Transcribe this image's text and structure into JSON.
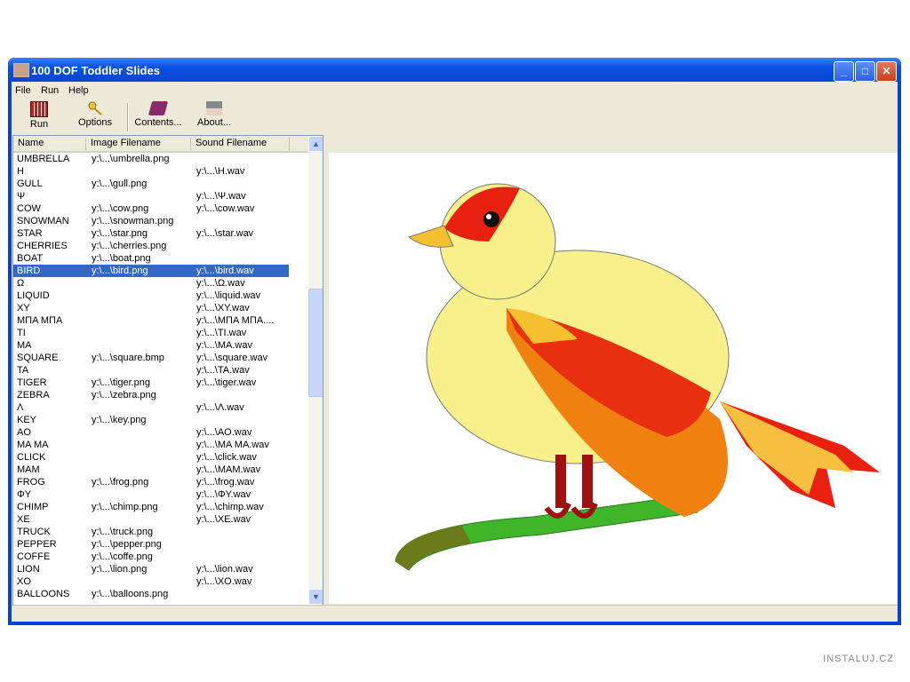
{
  "window": {
    "title": "100 DOF Toddler Slides",
    "controls": [
      "_",
      "□",
      "✕"
    ]
  },
  "menu": [
    "File",
    "Run",
    "Help"
  ],
  "toolbar": [
    {
      "label": "Run",
      "icon": "film-icon"
    },
    {
      "label": "Options",
      "icon": "key-icon"
    },
    {
      "label": "Contents...",
      "icon": "book-icon"
    },
    {
      "label": "About...",
      "icon": "picture-icon"
    }
  ],
  "list": {
    "columns": [
      "Name",
      "Image Filename",
      "Sound Filename"
    ],
    "selected": "BIRD",
    "rows": [
      [
        "UMBRELLA",
        "y:\\...\\umbrella.png",
        ""
      ],
      [
        "H",
        "",
        "y:\\...\\H.wav"
      ],
      [
        "GULL",
        "y:\\...\\gull.png",
        ""
      ],
      [
        "Ψ",
        "",
        "y:\\...\\Ψ.wav"
      ],
      [
        "COW",
        "y:\\...\\cow.png",
        "y:\\...\\cow.wav"
      ],
      [
        "SNOWMAN",
        "y:\\...\\snowman.png",
        ""
      ],
      [
        "STAR",
        "y:\\...\\star.png",
        "y:\\...\\star.wav"
      ],
      [
        "CHERRIES",
        "y:\\...\\cherries.png",
        ""
      ],
      [
        "BOAT",
        "y:\\...\\boat.png",
        ""
      ],
      [
        "BIRD",
        "y:\\...\\bird.png",
        "y:\\...\\bird.wav"
      ],
      [
        "Ω",
        "",
        "y:\\...\\Ω.wav"
      ],
      [
        "LIQUID",
        "",
        "y:\\...\\liquid.wav"
      ],
      [
        "XY",
        "",
        "y:\\...\\XY.wav"
      ],
      [
        "ΜΠΑ ΜΠΑ",
        "",
        "y:\\...\\ΜΠΑ ΜΠΑ...."
      ],
      [
        "TI",
        "",
        "y:\\...\\TI.wav"
      ],
      [
        "MA",
        "",
        "y:\\...\\MA.wav"
      ],
      [
        "SQUARE",
        "y:\\...\\square.bmp",
        "y:\\...\\square.wav"
      ],
      [
        "TA",
        "",
        "y:\\...\\TA.wav"
      ],
      [
        "TIGER",
        "y:\\...\\tiger.png",
        "y:\\...\\tiger.wav"
      ],
      [
        "ZEBRA",
        "y:\\...\\zebra.png",
        ""
      ],
      [
        "Λ",
        "",
        "y:\\...\\Λ.wav"
      ],
      [
        "KEY",
        "y:\\...\\key.png",
        ""
      ],
      [
        "AO",
        "",
        "y:\\...\\AO.wav"
      ],
      [
        "MA MA",
        "",
        "y:\\...\\MA MA.wav"
      ],
      [
        "CLICK",
        "",
        "y:\\...\\click.wav"
      ],
      [
        "MAM",
        "",
        "y:\\...\\MAM.wav"
      ],
      [
        "FROG",
        "y:\\...\\frog.png",
        "y:\\...\\frog.wav"
      ],
      [
        "ΦY",
        "",
        "y:\\...\\ΦY.wav"
      ],
      [
        "CHIMP",
        "y:\\...\\chimp.png",
        "y:\\...\\chimp.wav"
      ],
      [
        "XE",
        "",
        "y:\\...\\XE.wav"
      ],
      [
        "TRUCK",
        "y:\\...\\truck.png",
        ""
      ],
      [
        "PEPPER",
        "y:\\...\\pepper.png",
        ""
      ],
      [
        "COFFE",
        "y:\\...\\coffe.png",
        ""
      ],
      [
        "LION",
        "y:\\...\\lion.png",
        "y:\\...\\lion.wav"
      ],
      [
        "XO",
        "",
        "y:\\...\\XO.wav"
      ],
      [
        "BALLOONS",
        "y:\\...\\balloons.png",
        ""
      ]
    ]
  },
  "watermark": "INSTALUJ.CZ",
  "colors": {
    "titlebar": "#0a50e0",
    "selection": "#316ac5",
    "face": "#ece9d8"
  }
}
